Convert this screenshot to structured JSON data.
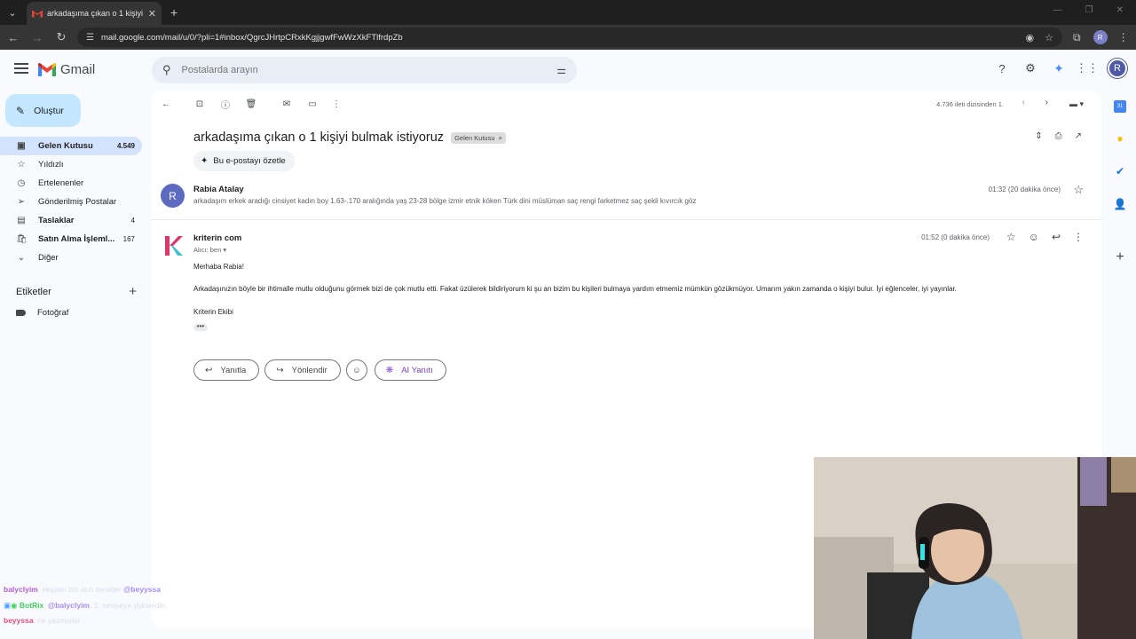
{
  "browser": {
    "tab_title": "arkadaşıma çıkan o 1 kişiyi bulm",
    "url": "mail.google.com/mail/u/0/?pli=1#inbox/QgrcJHrtpCRxkKgjjgwfFwWzXkFTlfrdpZb",
    "profile_initial": "R"
  },
  "gmail": {
    "brand": "Gmail",
    "search_placeholder": "Postalarda arayın",
    "compose_label": "Oluştur",
    "avatar_initial": "R"
  },
  "nav": [
    {
      "label": "Gelen Kutusu",
      "count": "4.549",
      "icon": "inbox-icon",
      "active": true
    },
    {
      "label": "Yıldızlı",
      "count": "",
      "icon": "star-icon"
    },
    {
      "label": "Ertelenenler",
      "count": "",
      "icon": "clock-icon"
    },
    {
      "label": "Gönderilmiş Postalar",
      "count": "",
      "icon": "send-icon"
    },
    {
      "label": "Taslaklar",
      "count": "4",
      "icon": "draft-icon"
    },
    {
      "label": "Satın Alma İşleml...",
      "count": "167",
      "icon": "purchase-icon"
    },
    {
      "label": "Diğer",
      "count": "",
      "icon": "chevron-down-icon"
    }
  ],
  "labels": {
    "heading": "Etiketler",
    "items": [
      "Fotoğraf"
    ]
  },
  "toolbar": {
    "pager_text": "4.736 ileti dizisinden 1."
  },
  "thread": {
    "subject": "arkadaşıma çıkan o 1 kişiyi bulmak istiyoruz",
    "label_chip": "Gelen Kutusu",
    "summarize_label": "Bu e-postayı özetle",
    "messages": [
      {
        "avatar": "R",
        "sender": "Rabia Atalay",
        "snippet": "arkadaşım erkek aradığı cinsiyet kadın boy 1.63-.170 aralığında yaş 23-28 bölge izmir etnik köken Türk dini müslüman saç rengi farketmez saç şekli kıvırcık göz",
        "time": "01:32 (20 dakika önce)"
      },
      {
        "avatar": "K",
        "sender": "kriterin com",
        "to": "Alıcı: ben",
        "time": "01:52 (0 dakika önce)",
        "body": [
          "Merhaba Rabia!",
          "Arkadaşınızın böyle bir ihtimalle mutlu olduğunu görmek bizi de çok mutlu etti. Fakat üzülerek bildiriyorum ki şu an bizim bu kişileri bulmaya yardım etmemiz mümkün gözükmüyor. Umarım yakın zamanda o kişiyi bulur. İyi eğlenceler, iyi yayınlar.",
          "Kriterin Ekibi"
        ]
      }
    ],
    "reply_label": "Yanıtla",
    "forward_label": "Yönlendir",
    "ai_reply_label": "AI Yanıtı"
  },
  "chat": [
    {
      "user": "balyclyim",
      "user_color": "#b45bd6",
      "text": ": ekipten biri atın beraber ",
      "mention": "@beyyssa"
    },
    {
      "user": "BotRix",
      "user_color": "#3fcf5a",
      "text": ": ",
      "mention": "@balyclyim",
      "text2": ", 1. seviyeye yükseldin."
    },
    {
      "user": "beyyssa",
      "user_color": "#e0527a",
      "text": ": ne yazmışlar"
    }
  ],
  "colors": {
    "accent": "#0b57d0",
    "active_nav": "#d3e3fd",
    "compose": "#c2e7ff",
    "ai": "#7b3fc6"
  }
}
